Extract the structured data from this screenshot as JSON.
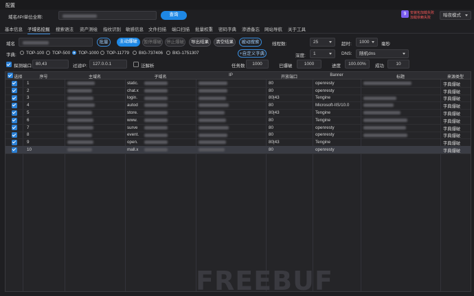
{
  "window": {
    "title": "配置"
  },
  "top": {
    "domain_label": "域名/IP/单位全称:",
    "query_button": "查询",
    "promo_line1": "安装包加载失败",
    "promo_line2": "加载依赖失败",
    "theme_select": "暗夜模式"
  },
  "tabs": [
    "基本信息",
    "子域名挖掘",
    "搜索语法",
    "资产测绘",
    "指纹识别",
    "敏感信息",
    "文件扫描",
    "端口扫描",
    "批量权重",
    "密码字典",
    "渗透备忘",
    "网站导航",
    "关于工具"
  ],
  "active_tab": "子域名挖掘",
  "toolbar": {
    "domain_label": "域名",
    "batch_button": "批量",
    "active_brute": "主动爆破",
    "pause_brute": "暂停爆破",
    "stop_brute": "停止爆破",
    "export_results": "导出结果",
    "clear_results": "清空结果",
    "passive_search": "被动搜索",
    "threads_label": "线程数:",
    "threads_value": "25",
    "timeout_label": "超时:",
    "timeout_value": "1000",
    "timeout_unit": "毫秒"
  },
  "dict": {
    "label": "字典:",
    "options": [
      "TOP-100",
      "TOP-500",
      "TOP-1000",
      "TOP-11779",
      "BIG-737406",
      "BIG-1751307"
    ],
    "selected": "TOP-1000",
    "custom_dict": "+自定义字典",
    "depth_label": "深度:",
    "depth_value": "1",
    "dns_label": "DNS:",
    "dns_value": "随机dns"
  },
  "options": {
    "probe_port_label": "探测端口",
    "probe_port_value": "80,43",
    "filter_ip_label": "过滤IP:",
    "filter_ip_value": "127.0.0.1",
    "pan_resolve_label": "泛解析",
    "task_count_label": "任务数",
    "task_count_value": "1000",
    "broken_label": "已爆破",
    "broken_value": "1000",
    "progress_label": "进度",
    "progress_value": "100.00%",
    "success_label": "成功",
    "success_value": "10"
  },
  "table": {
    "columns": [
      "选择",
      "序号",
      "主域名",
      "子域名",
      "IP",
      "开放端口",
      "Banner",
      "标题",
      "来源类型"
    ],
    "rows": [
      {
        "no": "1",
        "sub": "static.",
        "port": "80",
        "banner": "openresty",
        "source": "字典爆破"
      },
      {
        "no": "2",
        "sub": "chat.x",
        "port": "80",
        "banner": "openresty",
        "source": "字典爆破"
      },
      {
        "no": "3",
        "sub": "login.",
        "port": "80|43",
        "banner": "Tengine",
        "source": "字典爆破"
      },
      {
        "no": "4",
        "sub": "autod",
        "port": "80",
        "banner": "Microsoft-IIS/10.0",
        "source": "字典爆破"
      },
      {
        "no": "5",
        "sub": "store.",
        "port": "80|43",
        "banner": "Tengine",
        "source": "字典爆破"
      },
      {
        "no": "6",
        "sub": "www.",
        "port": "80",
        "banner": "Tengine",
        "source": "字典爆破"
      },
      {
        "no": "7",
        "sub": "surve",
        "port": "80",
        "banner": "openresty",
        "source": "字典爆破"
      },
      {
        "no": "8",
        "sub": "event.",
        "port": "80",
        "banner": "openresty",
        "source": "字典爆破"
      },
      {
        "no": "9",
        "sub": "open.",
        "port": "80|43",
        "banner": "Tengine",
        "source": "字典爆破"
      },
      {
        "no": "10",
        "sub": "mall.x",
        "port": "80",
        "banner": "openresty",
        "source": "字典爆破"
      }
    ]
  },
  "watermark": "FREEBUF",
  "colors": {
    "accent": "#1e88e5",
    "background": "#1f1f22",
    "selected_row": "#3a3c44"
  }
}
